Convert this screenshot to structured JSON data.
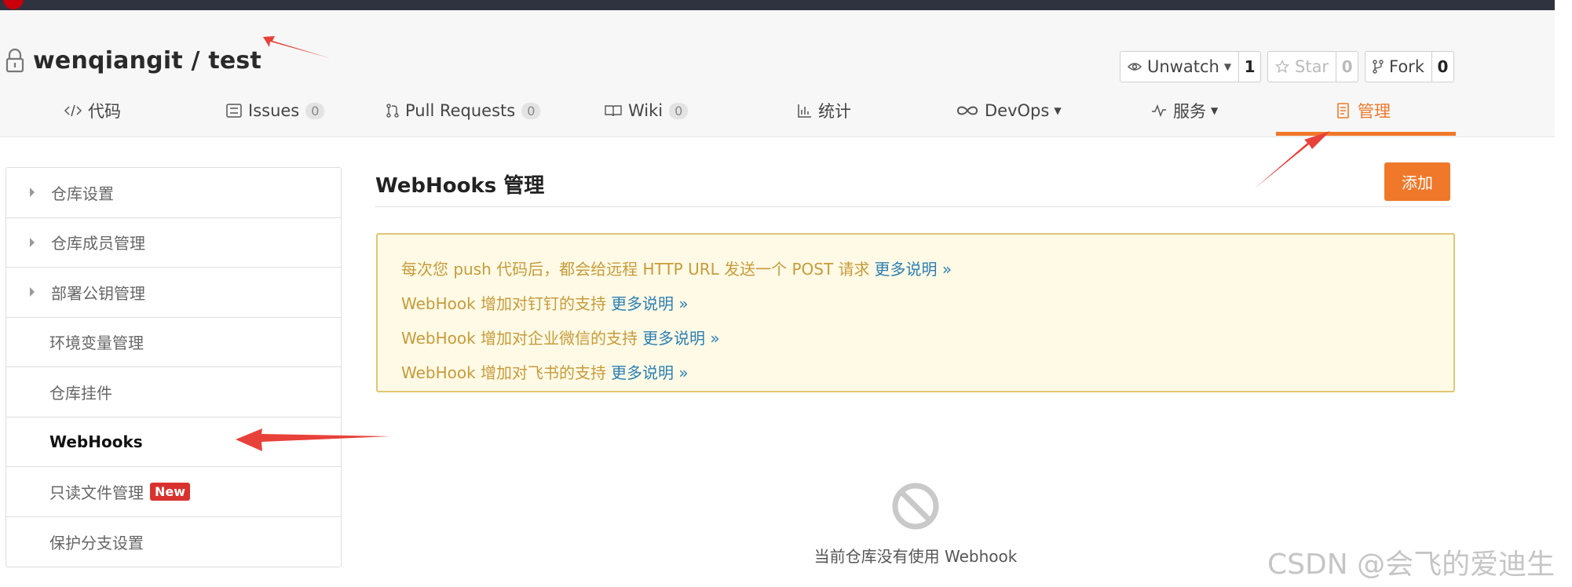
{
  "repo": {
    "title": "wenqiangit / test"
  },
  "actions": {
    "watch_label": "Unwatch",
    "watch_count": "1",
    "star_label": "Star",
    "star_count": "0",
    "fork_label": "Fork",
    "fork_count": "0"
  },
  "tabs": [
    {
      "label": "代码",
      "icon": "code-icon"
    },
    {
      "label": "Issues",
      "badge": "0",
      "icon": "issues-icon"
    },
    {
      "label": "Pull Requests",
      "badge": "0",
      "icon": "pull-request-icon"
    },
    {
      "label": "Wiki",
      "badge": "0",
      "icon": "wiki-icon"
    },
    {
      "label": "统计",
      "icon": "stats-icon"
    },
    {
      "label": "DevOps",
      "icon": "infinity-icon"
    },
    {
      "label": "服务",
      "icon": "pulse-icon"
    },
    {
      "label": "管理",
      "icon": "manage-icon",
      "active": true
    }
  ],
  "sidebar": {
    "items": [
      {
        "label": "仓库设置"
      },
      {
        "label": "仓库成员管理"
      },
      {
        "label": "部署公钥管理"
      },
      {
        "label": "环境变量管理"
      },
      {
        "label": "仓库挂件"
      },
      {
        "label": "WebHooks",
        "active": true
      },
      {
        "label": "只读文件管理",
        "badge": "New"
      },
      {
        "label": "保护分支设置"
      }
    ]
  },
  "main": {
    "title": "WebHooks 管理",
    "add_label": "添加",
    "notice": [
      {
        "text": "每次您 push 代码后，都会给远程 HTTP URL 发送一个 POST 请求",
        "link": "更多说明 »"
      },
      {
        "text": "WebHook 增加对钉钉的支持",
        "link": "更多说明 »"
      },
      {
        "text": "WebHook 增加对企业微信的支持",
        "link": "更多说明 »"
      },
      {
        "text": "WebHook 增加对飞书的支持",
        "link": "更多说明 »"
      }
    ],
    "empty_text": "当前仓库没有使用 Webhook"
  },
  "watermark": "CSDN @会飞的爱迪生",
  "colors": {
    "accent": "#f0782a",
    "arrow": "#e8413a",
    "notice_text": "#c79b3a",
    "link": "#2b7fb3",
    "new_badge": "#d9322e"
  }
}
